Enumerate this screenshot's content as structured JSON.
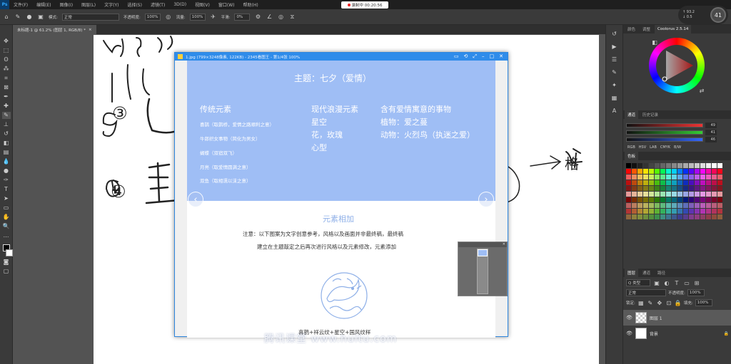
{
  "menubar": {
    "app_icon": "Ps",
    "items": [
      "文件(F)",
      "编辑(E)",
      "图像(I)",
      "图层(L)",
      "文字(Y)",
      "选择(S)",
      "滤镜(T)",
      "3D(D)",
      "视图(V)",
      "窗口(W)",
      "帮助(H)"
    ]
  },
  "recording": {
    "label": "录制中 00:20:56",
    "dot_color": "#e22222"
  },
  "options_bar": {
    "mode_label": "模式:",
    "mode_value": "正常",
    "opacity_label": "不透明度:",
    "opacity_value": "100%",
    "flow_label": "流量:",
    "flow_value": "100%",
    "smooth_label": "平滑:",
    "smooth_value": "0%"
  },
  "perf_widget": {
    "up_rate": "↑ 93.2",
    "down_rate": "↓ 0.5",
    "cpu": "41"
  },
  "document_tab": {
    "title": "未标题-1 @ 61.2% (图层 1, RGB/8) *",
    "close": "×"
  },
  "tools": [
    "move-tool",
    "marquee-tool",
    "lasso-tool",
    "magic-wand-tool",
    "crop-tool",
    "frame-tool",
    "eyedropper-tool",
    "healing-tool",
    "brush-tool",
    "stamp-tool",
    "history-brush-tool",
    "eraser-tool",
    "gradient-tool",
    "blur-tool",
    "dodge-tool",
    "pen-tool",
    "type-tool",
    "path-select-tool",
    "shape-tool",
    "hand-tool",
    "zoom-tool",
    "more-tools"
  ],
  "canvas": {
    "numbers": [
      "③",
      "④"
    ],
    "arrow_word": "格"
  },
  "viewer": {
    "title": "1.jpg (799×3248像素, 122KB) - 2345看图王 - 第1/4张 100%",
    "controls": [
      "minimize-icon",
      "settings-icon",
      "fullscreen-icon",
      "restore-icon",
      "maximize-icon",
      "close-icon"
    ],
    "heading": "主题：七夕（爱情）",
    "col1_title": "传统元素",
    "col1_items": [
      "喜鹊（取鹊桥，爱情之路顺利之意）",
      "牛郎织女事物（简化为男女）",
      "蝴蝶（双宿双飞）",
      "月亮（取爱情圆满之意）",
      "双鱼（取相濡以沫之意）"
    ],
    "col2_title": "现代浪漫元素",
    "col2_items": [
      "星空",
      "花，玫瑰",
      "心型"
    ],
    "col3_title": "含有爱情寓意的事物",
    "col3_items": [
      "植物：爱之蔓",
      "动物：火烈鸟（执迷之爱）"
    ],
    "section_title": "元素相加",
    "note_lines": [
      "注意：以下图案为文字创意参考，风格以及画面并非最终稿，最终稿",
      "建立在主题敲定之后再次进行风格以及元素修改，元素添加"
    ],
    "caption": "喜鹊+祥云纹+星空+国风纹样",
    "prev": "‹",
    "next": "›"
  },
  "watermark": "腾讯课堂 www.huitu.com",
  "right_strip_icons": [
    "history-icon",
    "actions-icon",
    "properties-icon",
    "paths-icon",
    "brush-settings-icon",
    "swatches-icon",
    "character-icon"
  ],
  "color_panel": {
    "tabs": [
      "颜色",
      "调整",
      "Coolorus 2.5.14"
    ],
    "wheel_colors": [
      "#ff0000",
      "#ffff00",
      "#00ff00",
      "#00ffff",
      "#0000ff",
      "#ff00ff",
      "#ff0000"
    ]
  },
  "sliders_panel": {
    "tabs": [
      "通道",
      "历史记录"
    ],
    "values": [
      "49",
      "41",
      "46"
    ],
    "gradients": [
      "#e33",
      "#3c3",
      "#36f"
    ],
    "modes": [
      "RGB",
      "HSV",
      "LAB",
      "CMYK",
      "B/W"
    ]
  },
  "swatches_panel": {
    "title": "色板"
  },
  "layers_panel": {
    "tabs": [
      "图层",
      "通道",
      "路径"
    ],
    "filter_label": "Q 类型",
    "blend_mode": "正常",
    "opacity_label": "不透明度:",
    "opacity_value": "100%",
    "lock_label": "锁定:",
    "fill_label": "填充:",
    "fill_value": "100%",
    "layers": [
      {
        "name": "图层 1",
        "selected": true
      },
      {
        "name": "背景",
        "selected": false
      }
    ]
  }
}
